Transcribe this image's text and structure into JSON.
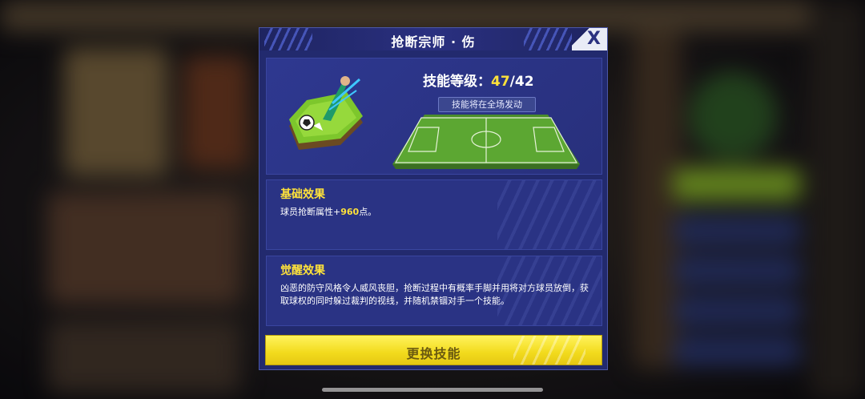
{
  "dialog": {
    "title": "抢断宗师 · 伤",
    "close_label": "X"
  },
  "skill": {
    "level_label": "技能等级：",
    "level_current": "47",
    "level_max": "/42",
    "trigger_tag": "技能将在全场发动"
  },
  "effects": {
    "base": {
      "title": "基础效果",
      "text_prefix": "球员抢断属性+",
      "value": "960",
      "text_suffix": "点。"
    },
    "awakening": {
      "title": "觉醒效果",
      "text": "凶恶的防守风格令人威风丧胆，抢断过程中有概率手脚并用将对方球员放倒，获取球权的同时躲过裁判的视线，并随机禁锢对手一个技能。"
    }
  },
  "actions": {
    "change_skill": "更换技能"
  },
  "colors": {
    "accent_yellow": "#ffe23a",
    "panel_blue": "#2a3384",
    "button_yellow": "#f2da1c"
  }
}
